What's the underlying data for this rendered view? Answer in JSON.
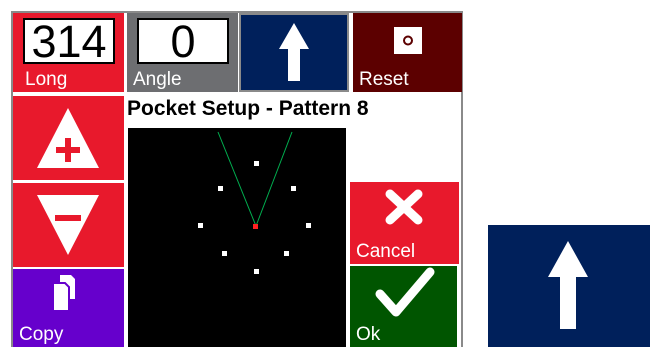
{
  "long": {
    "value": "314",
    "label": "Long",
    "color": "#e8192c"
  },
  "angle": {
    "value": "0",
    "label": "Angle",
    "color": "#6d6e71"
  },
  "up_button": {
    "icon": "up-arrow-icon",
    "color": "#00205b"
  },
  "reset": {
    "label": "Reset",
    "icon": "reset-icon",
    "color": "#5c0000"
  },
  "increase": {
    "icon": "plus-triangle-icon",
    "color": "#e8192c"
  },
  "decrease": {
    "icon": "minus-triangle-icon",
    "color": "#e8192c"
  },
  "copy": {
    "label": "Copy",
    "icon": "copy-icon",
    "color": "#6600cc"
  },
  "title": "Pocket Setup - Pattern 8",
  "cancel": {
    "label": "Cancel",
    "icon": "x-icon",
    "color": "#e8192c"
  },
  "ok": {
    "label": "Ok",
    "icon": "check-icon",
    "color": "#005500"
  },
  "side_up_button": {
    "icon": "up-arrow-icon",
    "color": "#00205b"
  }
}
